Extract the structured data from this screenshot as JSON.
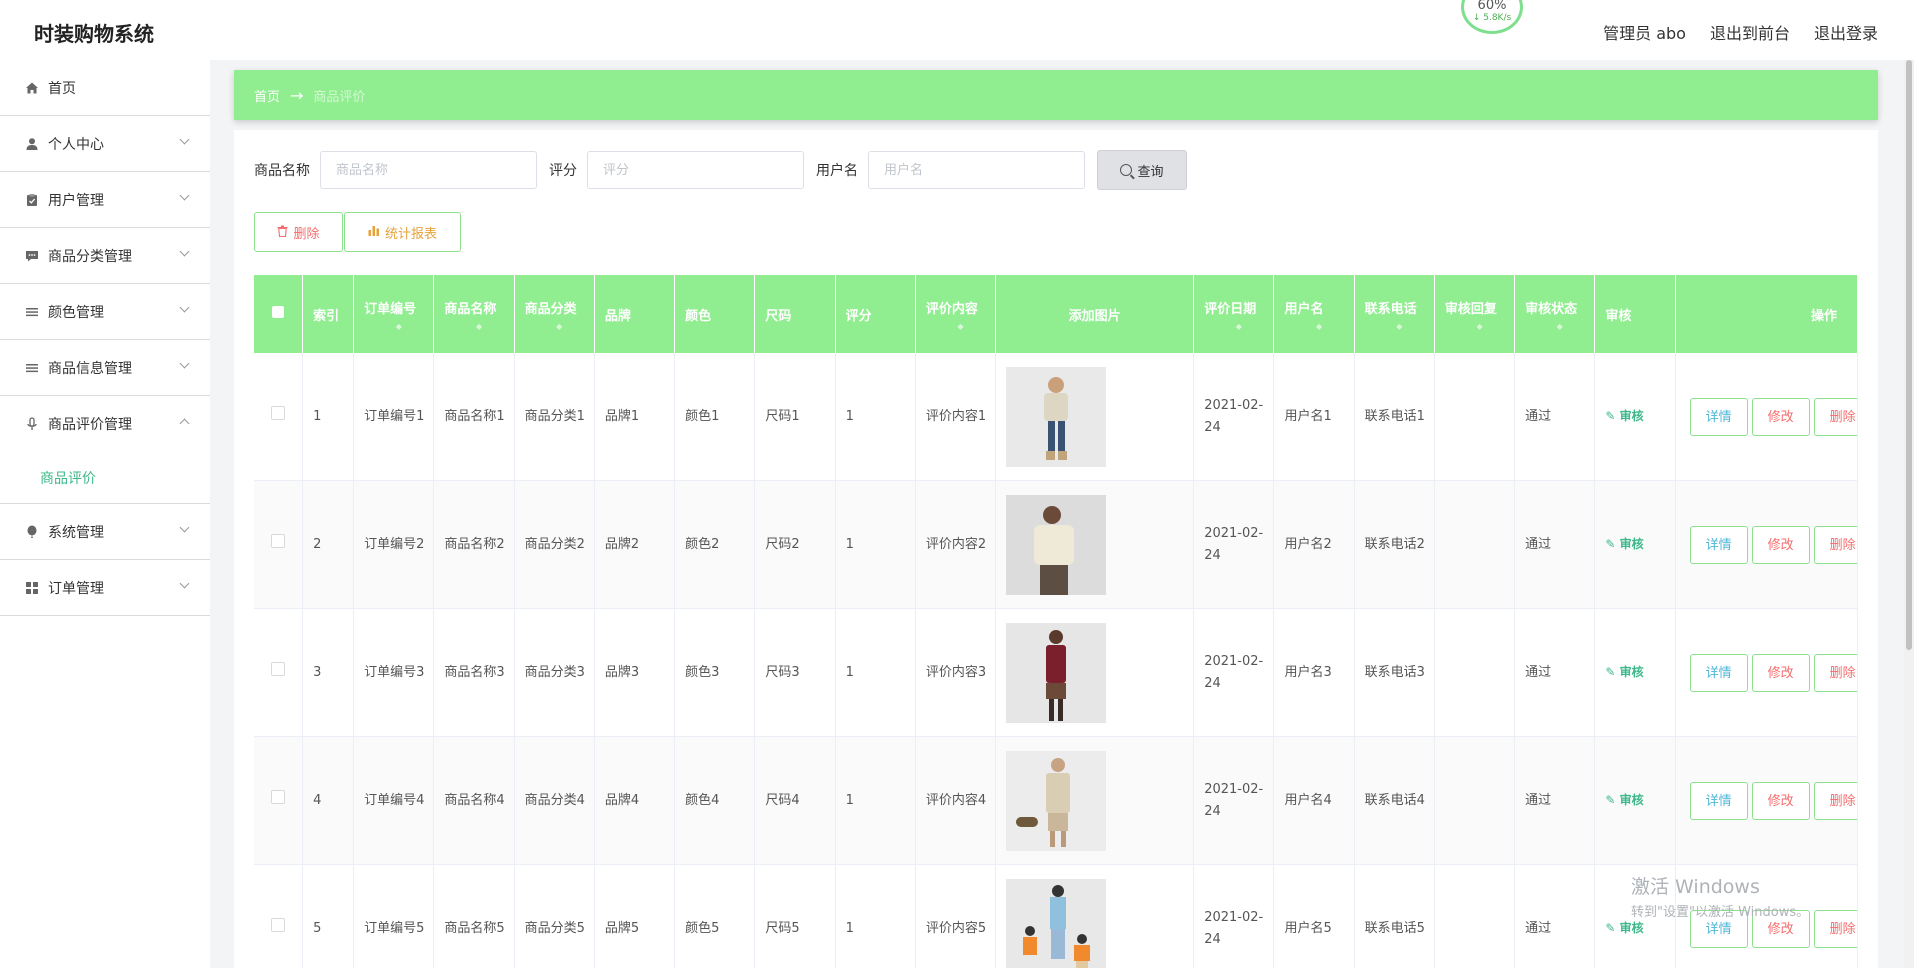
{
  "app": {
    "title": "时装购物系统"
  },
  "net_widget": {
    "percent": "60%",
    "speed": "↓ 5.8K/s"
  },
  "header": {
    "admin_label": "管理员 abo",
    "back_to_front": "退出到前台",
    "logout": "退出登录"
  },
  "sidebar": {
    "items": [
      {
        "label": "首页",
        "icon": "home-icon",
        "expandable": false
      },
      {
        "label": "个人中心",
        "icon": "user-icon",
        "expandable": true
      },
      {
        "label": "用户管理",
        "icon": "clipboard-icon",
        "expandable": true
      },
      {
        "label": "商品分类管理",
        "icon": "chat-icon",
        "expandable": true
      },
      {
        "label": "颜色管理",
        "icon": "list-icon",
        "expandable": true
      },
      {
        "label": "商品信息管理",
        "icon": "list-icon",
        "expandable": true
      },
      {
        "label": "商品评价管理",
        "icon": "microphone-icon",
        "expandable": true,
        "expanded": true
      },
      {
        "label": "系统管理",
        "icon": "balloon-icon",
        "expandable": true
      },
      {
        "label": "订单管理",
        "icon": "grid-icon",
        "expandable": true
      }
    ],
    "sub_item": "商品评价"
  },
  "breadcrumb": {
    "home": "首页",
    "arrow": "→",
    "current": "商品评价"
  },
  "search": {
    "product_name_label": "商品名称",
    "product_name_placeholder": "商品名称",
    "rating_label": "评分",
    "rating_placeholder": "评分",
    "username_label": "用户名",
    "username_placeholder": "用户名",
    "query_button": "查询"
  },
  "actions": {
    "delete": "删除",
    "report": "统计报表"
  },
  "table": {
    "headers": [
      "索引",
      "订单编号",
      "商品名称",
      "商品分类",
      "品牌",
      "颜色",
      "尺码",
      "评分",
      "评价内容",
      "添加图片",
      "评价日期",
      "用户名",
      "联系电话",
      "审核回复",
      "审核状态",
      "审核",
      "操作"
    ],
    "rows": [
      {
        "index": "1",
        "order_no": "订单编号1",
        "product_name": "商品名称1",
        "category": "商品分类1",
        "brand": "品牌1",
        "color": "颜色1",
        "size": "尺码1",
        "rating": "1",
        "content": "评价内容1",
        "date": "2021-02-24",
        "username": "用户名1",
        "phone": "联系电话1",
        "reply": "",
        "status": "通过"
      },
      {
        "index": "2",
        "order_no": "订单编号2",
        "product_name": "商品名称2",
        "category": "商品分类2",
        "brand": "品牌2",
        "color": "颜色2",
        "size": "尺码2",
        "rating": "1",
        "content": "评价内容2",
        "date": "2021-02-24",
        "username": "用户名2",
        "phone": "联系电话2",
        "reply": "",
        "status": "通过"
      },
      {
        "index": "3",
        "order_no": "订单编号3",
        "product_name": "商品名称3",
        "category": "商品分类3",
        "brand": "品牌3",
        "color": "颜色3",
        "size": "尺码3",
        "rating": "1",
        "content": "评价内容3",
        "date": "2021-02-24",
        "username": "用户名3",
        "phone": "联系电话3",
        "reply": "",
        "status": "通过"
      },
      {
        "index": "4",
        "order_no": "订单编号4",
        "product_name": "商品名称4",
        "category": "商品分类4",
        "brand": "品牌4",
        "color": "颜色4",
        "size": "尺码4",
        "rating": "1",
        "content": "评价内容4",
        "date": "2021-02-24",
        "username": "用户名4",
        "phone": "联系电话4",
        "reply": "",
        "status": "通过"
      },
      {
        "index": "5",
        "order_no": "订单编号5",
        "product_name": "商品名称5",
        "category": "商品分类5",
        "brand": "品牌5",
        "color": "颜色5",
        "size": "尺码5",
        "rating": "1",
        "content": "评价内容5",
        "date": "2021-02-24",
        "username": "用户名5",
        "phone": "联系电话5",
        "reply": "",
        "status": "通过"
      }
    ],
    "audit_label": "审核",
    "op_detail": "详情",
    "op_edit": "修改",
    "op_delete": "删除"
  },
  "watermark": {
    "line1": "激活 Windows",
    "line2": "转到\"设置\"以激活 Windows。"
  },
  "colors": {
    "accent": "#90ee90",
    "link": "#3cb88a",
    "danger": "#f56c6c",
    "warning": "#e6a23c"
  }
}
